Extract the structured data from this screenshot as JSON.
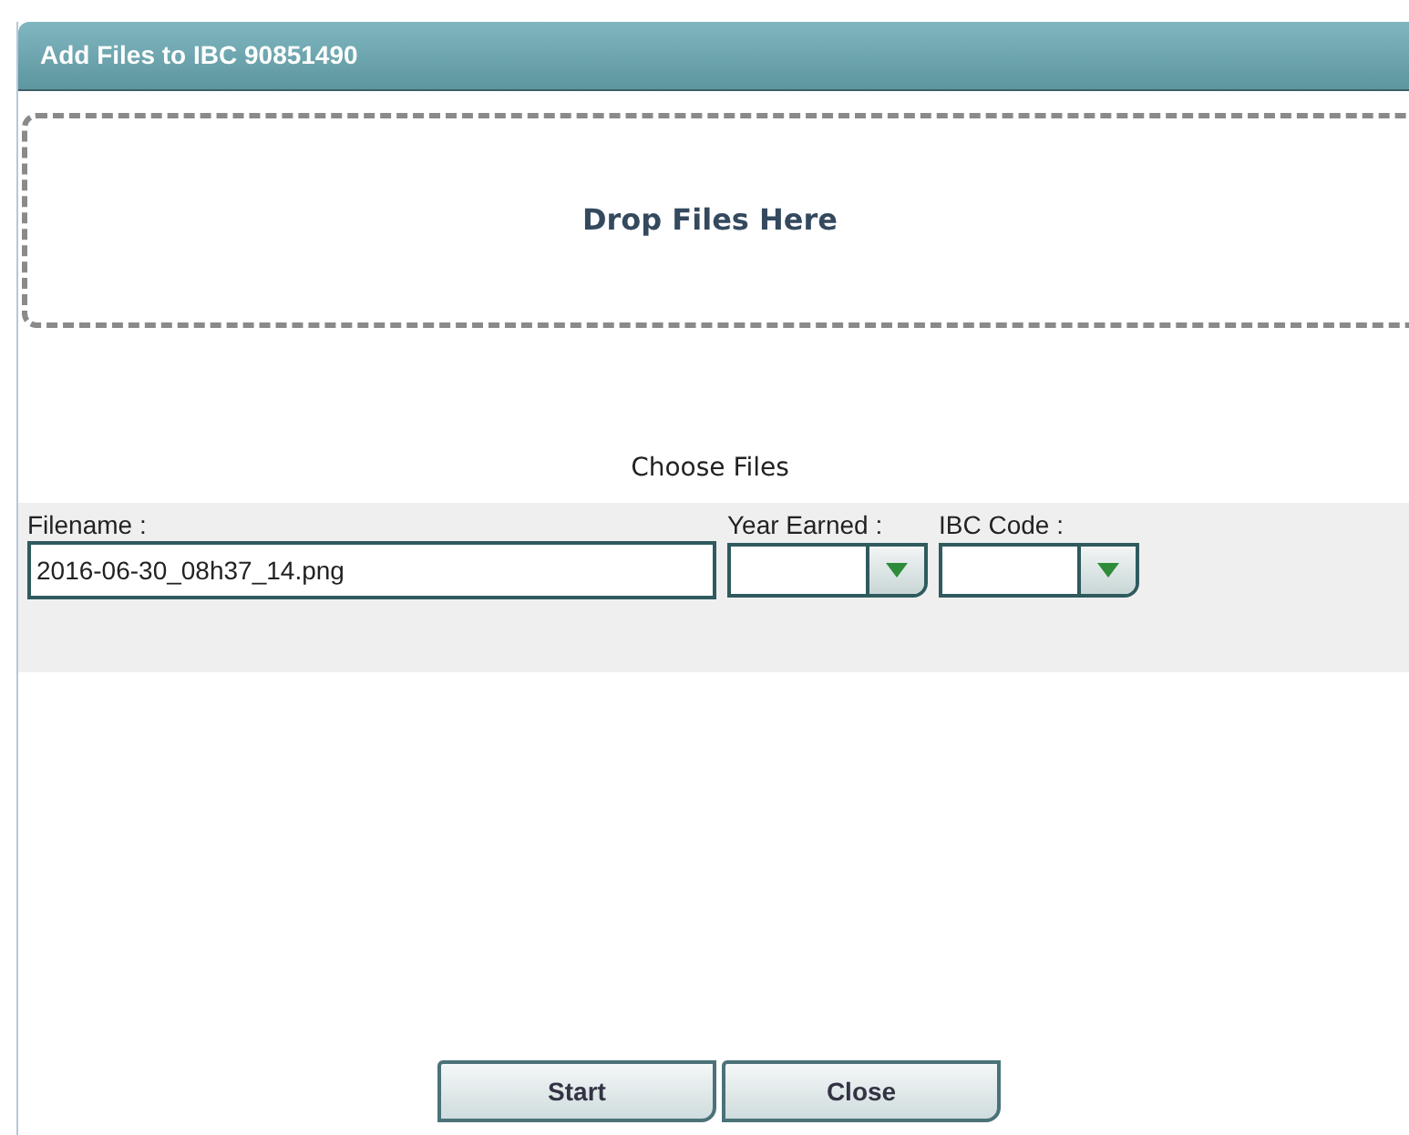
{
  "window": {
    "title": "Add Files to IBC 90851490"
  },
  "drop_zone": {
    "label": "Drop Files Here"
  },
  "choose_files": {
    "label": "Choose Files"
  },
  "fields": [
    {
      "kind": "text",
      "label": "Filename :",
      "value": "2016-06-30_08h37_14.png"
    },
    {
      "kind": "select",
      "label": "Year Earned :"
    },
    {
      "kind": "select",
      "label": "IBC Code :"
    }
  ],
  "buttons": [
    "Start",
    "Close"
  ]
}
